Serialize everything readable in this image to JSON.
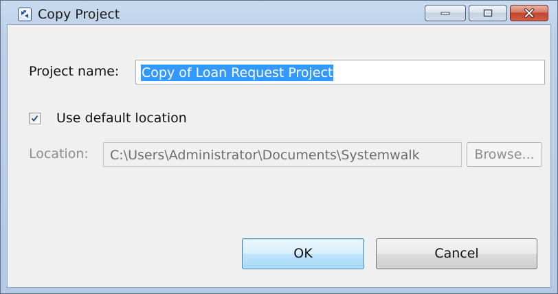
{
  "window": {
    "title": "Copy Project"
  },
  "titlebar_buttons": {
    "minimize": "minimize-icon",
    "maximize": "maximize-icon",
    "close": "close-icon"
  },
  "form": {
    "project_name_label": "Project name:",
    "project_name_value": "Copy of Loan Request Project",
    "use_default_label": "Use default location",
    "use_default_checked": true,
    "location_label": "Location:",
    "location_value": "C:\\Users\\Administrator\\Documents\\Systemwalk",
    "browse_label": "Browse..."
  },
  "buttons": {
    "ok_label": "OK",
    "cancel_label": "Cancel"
  },
  "colors": {
    "selection": "#3399ff",
    "close_button": "#c4432c",
    "titlebar": "#b4c9e3"
  }
}
